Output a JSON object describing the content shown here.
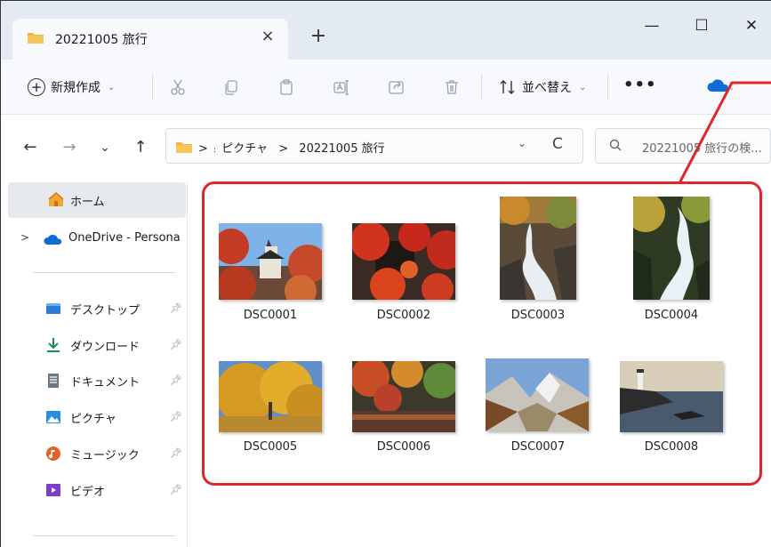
{
  "tab": {
    "title": "20221005 旅行",
    "close_glyph": "×",
    "add_glyph": "+"
  },
  "window_controls": {
    "minimize": "—",
    "maximize": "☐",
    "close": "✕"
  },
  "commandbar": {
    "new_label": "新規作成",
    "new_icon": "plus-circle-icon",
    "sort_label": "並べ替え",
    "more_label": "•••",
    "icons": [
      "cut-icon",
      "copy-icon",
      "paste-icon",
      "rename-icon",
      "share-icon",
      "delete-icon"
    ]
  },
  "nav": {
    "back": "←",
    "forward": "→",
    "recent": "⌄",
    "up": "↑"
  },
  "address": {
    "prefix": ">",
    "segments": [
      "ピクチャ",
      "20221005 旅行"
    ],
    "separator": ">",
    "dropdown": "⌄",
    "refresh": "C"
  },
  "search": {
    "placeholder": "20221005 旅行の検..."
  },
  "sidebar": {
    "home": "ホーム",
    "onedrive": "OneDrive - Persona",
    "expand": ">",
    "quick_access": [
      {
        "label": "デスクトップ",
        "icon": "desktop-icon",
        "color": "#2b7bd8"
      },
      {
        "label": "ダウンロード",
        "icon": "download-icon",
        "color": "#1e8c5a"
      },
      {
        "label": "ドキュメント",
        "icon": "document-icon",
        "color": "#6b7683"
      },
      {
        "label": "ピクチャ",
        "icon": "pictures-icon",
        "color": "#2a8ee0"
      },
      {
        "label": "ミュージック",
        "icon": "music-icon",
        "color": "#e2622b"
      },
      {
        "label": "ビデオ",
        "icon": "video-icon",
        "color": "#7a3ec9"
      }
    ]
  },
  "files": [
    {
      "name": "DSC0001",
      "scene": "castle-autumn"
    },
    {
      "name": "DSC0002",
      "scene": "temple-maple"
    },
    {
      "name": "DSC0003",
      "scene": "waterfall-rocks"
    },
    {
      "name": "DSC0004",
      "scene": "waterfall-forest"
    },
    {
      "name": "DSC0005",
      "scene": "ginkgo-tree"
    },
    {
      "name": "DSC0006",
      "scene": "garden-pond"
    },
    {
      "name": "DSC0007",
      "scene": "mountain-valley"
    },
    {
      "name": "DSC0008",
      "scene": "lighthouse-coast"
    }
  ],
  "colors": {
    "accent_annotation": "#e0262b",
    "titlebar": "#e4eaf3",
    "selection": "#e6e9ee",
    "folder": "#f2b53a"
  }
}
